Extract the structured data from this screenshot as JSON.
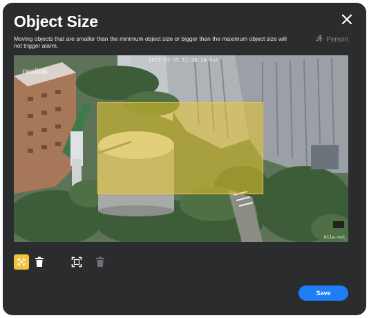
{
  "dialog": {
    "title": "Object Size",
    "description": "Moving objects that are smaller than the minimum object size or bigger than the maximum object size will not trigger alarm.",
    "object_type_label": "Person",
    "close_icon": "close-icon",
    "person_icon": "running-person-icon"
  },
  "camera": {
    "timestamp": "2021-03-25 11:50:14 Sat",
    "watermark": "reolink",
    "channel_name": "811a-out"
  },
  "toolbar": {
    "tools": [
      {
        "name": "min-size-tool",
        "icon": "min-size-icon",
        "active": true
      },
      {
        "name": "delete-min-tool",
        "icon": "trash-icon",
        "active": false
      },
      {
        "name": "max-size-tool",
        "icon": "max-size-icon",
        "active": false
      },
      {
        "name": "delete-max-tool",
        "icon": "trash-icon",
        "active": false,
        "disabled": true
      }
    ]
  },
  "actions": {
    "save_label": "Save"
  },
  "colors": {
    "accent": "#1f7ef5",
    "highlight": "#f2c23f",
    "background": "#2b2c2e"
  }
}
